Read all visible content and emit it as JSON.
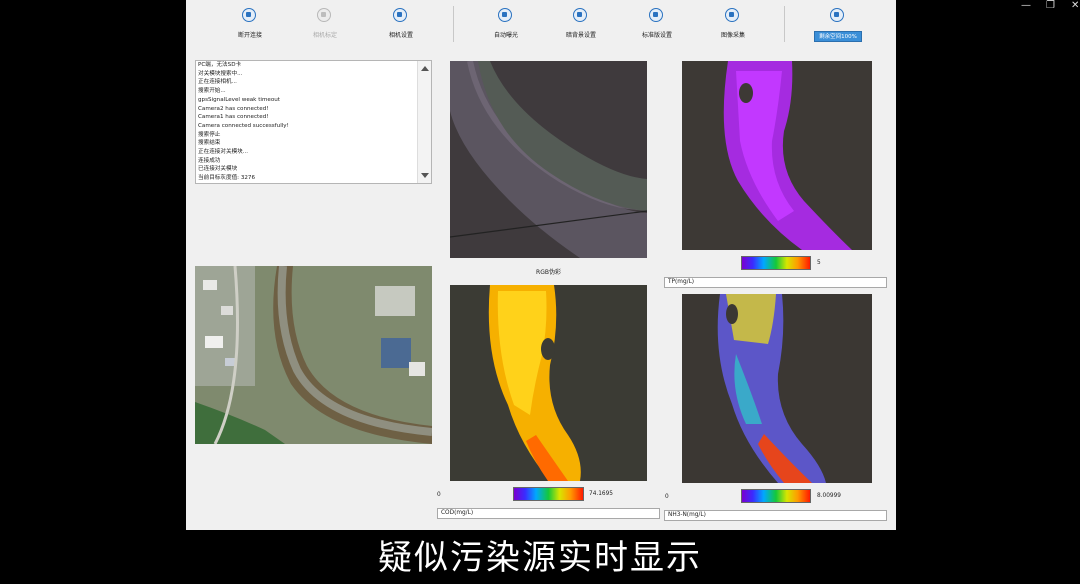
{
  "toolbar": {
    "disconnect": "断开连接",
    "calibrate": "相机标定",
    "camera_settings": "相机设置",
    "auto_exposure": "自动曝光",
    "dark_bg_settings": "暗背景设置",
    "standard_board_settings": "标准版设置",
    "image_capture": "图像采集",
    "remaining_space": "剩余空间100%"
  },
  "log": {
    "lines": [
      "PC端，无法SD卡",
      "对关模块搜索中...",
      "正在连接相机...",
      "搜索开始...",
      "gpsSignalLevel weak timeout",
      "Camera2 has connected!",
      "Camera1 has connected!",
      "Camera connected successfully!",
      "搜索停止",
      "搜索结束",
      "正在连接对关模块...",
      "连接成功",
      "已连接对关模块",
      "当前目标灰度值: 3276"
    ]
  },
  "panels": {
    "rgb": {
      "caption": "RGB伪彩"
    },
    "tp": {
      "min": "",
      "max": "5",
      "field": "TP(mg/L)"
    },
    "cod": {
      "min": "0",
      "max": "74.1695",
      "field": "COD(mg/L)"
    },
    "nh3": {
      "min": "0",
      "max": "8.00999",
      "field": "NH3-N(mg/L)"
    }
  },
  "subtitle": "疑似污染源实时显示",
  "icons": {
    "toolbar": [
      "camera-icon",
      "calibrate-icon",
      "settings-menu-icon",
      "exposure-icon",
      "moon-icon",
      "target-icon",
      "book-icon",
      "storage-icon"
    ],
    "window": [
      "minimize-icon",
      "restore-icon",
      "close-icon"
    ]
  },
  "colors": {
    "accent": "#3b8fd8",
    "colorbar": [
      "#7a00d0",
      "#3a2cff",
      "#00a8ff",
      "#14c83a",
      "#d8e600",
      "#ff9a00",
      "#ff1a00"
    ]
  }
}
